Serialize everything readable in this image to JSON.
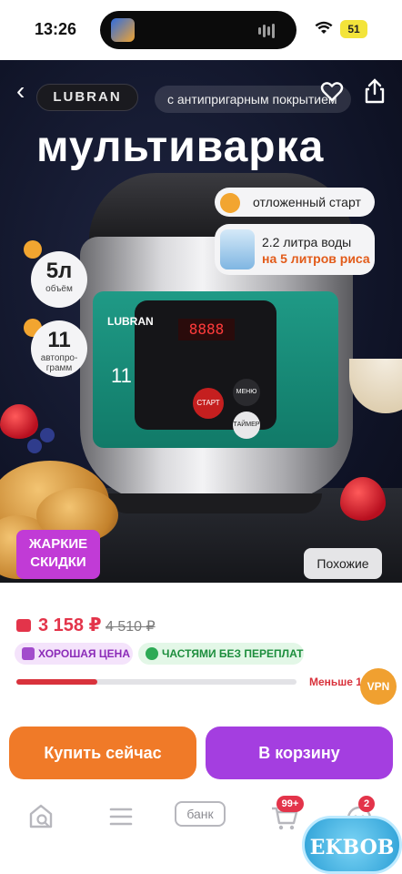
{
  "status_bar": {
    "time": "13:26",
    "battery": "51"
  },
  "product_image": {
    "brand": "LUBRAN",
    "tagline": "с антипригарным покрытием",
    "title": "мультиварка",
    "features": {
      "delayed_start": "отложенный старт",
      "capacity_line1": "2.2 литра воды",
      "capacity_line2": "на 5 литров риса"
    },
    "volume": {
      "value": "5л",
      "label": "объём"
    },
    "programs": {
      "value": "11",
      "label1": "автопро-",
      "label2": "грамм"
    },
    "device": {
      "brand": "LUBRAN",
      "display": "8888",
      "start_label": "СТАРТ",
      "menu_label": "МЕНЮ",
      "timer_label": "ТАЙМЕР",
      "programs_count": "11"
    },
    "hot_badge_line1": "ЖАРКИЕ",
    "hot_badge_line2": "СКИДКИ",
    "similar_button": "Похожие"
  },
  "pricing": {
    "price": "3 158 ₽",
    "old_price": "4 510 ₽",
    "tag_good_price": "ХОРОШАЯ ЦЕНА",
    "tag_installments": "ЧАСТЯМИ БЕЗ ПЕРЕПЛАТ",
    "stock_progress": 0.29,
    "stock_text": "Меньше 1"
  },
  "vpn_label": "VPN",
  "actions": {
    "buy_now": "Купить сейчас",
    "add_to_cart": "В корзину"
  },
  "bottom_nav": {
    "bank_label": "банк",
    "cart_badge": "99+",
    "profile_badge": "2"
  },
  "watermark": "EKBOB",
  "colors": {
    "accent_red": "#e3344a",
    "buy_orange": "#f07a28",
    "cart_purple": "#a43ee0",
    "hot_badge": "#c13bd6"
  }
}
